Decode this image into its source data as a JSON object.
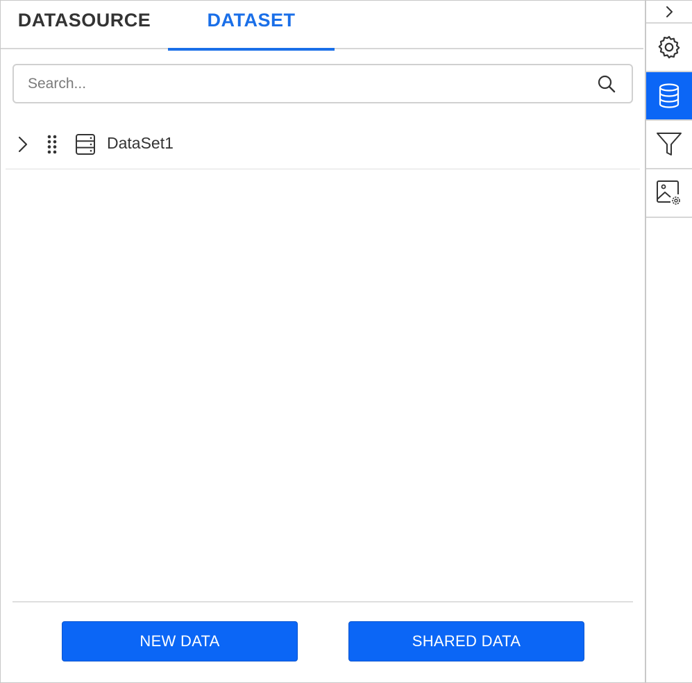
{
  "tabs": {
    "datasource_label": "DATASOURCE",
    "dataset_label": "DATASET",
    "active": "DATASET"
  },
  "search": {
    "placeholder": "Search...",
    "value": ""
  },
  "tree": {
    "items": [
      {
        "label": "DataSet1",
        "icon": "dataset-table-icon",
        "expanded": false
      }
    ]
  },
  "footer": {
    "new_data_label": "NEW DATA",
    "shared_data_label": "SHARED DATA"
  },
  "rail": {
    "items": [
      {
        "name": "collapse",
        "icon": "chevron-right-icon"
      },
      {
        "name": "settings",
        "icon": "gear-icon"
      },
      {
        "name": "data",
        "icon": "database-icon",
        "active": true
      },
      {
        "name": "filter",
        "icon": "filter-icon"
      },
      {
        "name": "image-settings",
        "icon": "image-settings-icon"
      }
    ]
  },
  "colors": {
    "accent": "#0b66f6",
    "active_tab_text": "#1a6fe8",
    "text": "#333333",
    "border": "#d0d0d0"
  }
}
